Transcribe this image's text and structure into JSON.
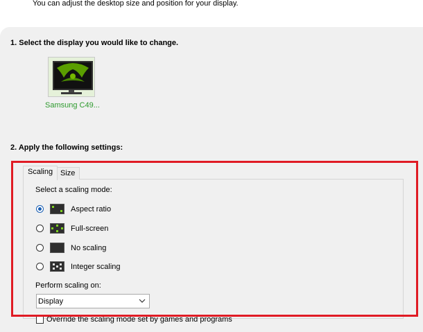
{
  "intro_text": "You can adjust the desktop size and position for your display.",
  "section1": {
    "title": "1. Select the display you would like to change.",
    "display_name": "Samsung C49..."
  },
  "section2": {
    "title": "2. Apply the following settings:"
  },
  "tabs": [
    "Scaling",
    "Size"
  ],
  "active_tab": "Scaling",
  "scaling": {
    "mode_label": "Select a scaling mode:",
    "modes": [
      {
        "label": "Aspect ratio",
        "checked": true,
        "icon": "aspect-ratio-icon"
      },
      {
        "label": "Full-screen",
        "checked": false,
        "icon": "full-screen-icon"
      },
      {
        "label": "No scaling",
        "checked": false,
        "icon": "no-scaling-icon"
      },
      {
        "label": "Integer scaling",
        "checked": false,
        "icon": "integer-scaling-icon"
      }
    ],
    "perform_label": "Perform scaling on:",
    "perform_value": "Display",
    "override_label": "Override the scaling mode set by games and programs",
    "override_checked": false
  },
  "colors": {
    "accent": "#1a5fb4",
    "nvidia_green": "#76b900",
    "highlight_border": "#e01b24",
    "display_label": "#2d9a2d"
  }
}
